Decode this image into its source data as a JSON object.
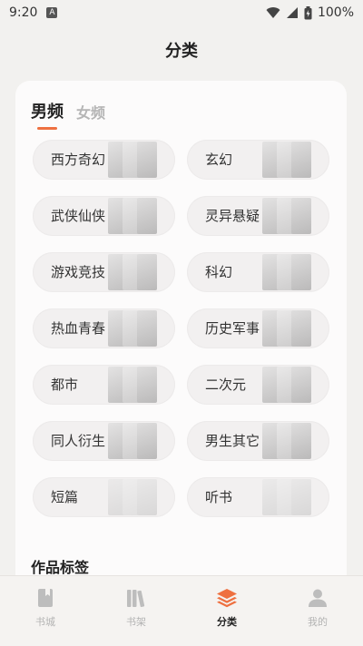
{
  "status_bar": {
    "time": "9:20",
    "app_icon_glyph": "A",
    "battery_text": "100%"
  },
  "page_title": "分类",
  "gender_tabs": [
    {
      "label": "男频",
      "active": true
    },
    {
      "label": "女频",
      "active": false
    }
  ],
  "categories": [
    {
      "label": "西方奇幻"
    },
    {
      "label": "玄幻"
    },
    {
      "label": "武侠仙侠"
    },
    {
      "label": "灵异悬疑"
    },
    {
      "label": "游戏竞技"
    },
    {
      "label": "科幻"
    },
    {
      "label": "热血青春"
    },
    {
      "label": "历史军事"
    },
    {
      "label": "都市"
    },
    {
      "label": "二次元"
    },
    {
      "label": "同人衍生"
    },
    {
      "label": "男生其它"
    },
    {
      "label": "短篇"
    },
    {
      "label": "听书"
    }
  ],
  "section_header": "作品标签",
  "bottom_nav": [
    {
      "label": "书城",
      "icon": "book-icon",
      "active": false
    },
    {
      "label": "书架",
      "icon": "bookshelf-icon",
      "active": false
    },
    {
      "label": "分类",
      "icon": "layers-icon",
      "active": true
    },
    {
      "label": "我的",
      "icon": "user-icon",
      "active": false
    }
  ],
  "colors": {
    "accent": "#EE7040",
    "background": "#F2F1EF",
    "card": "#FCFBFB"
  }
}
